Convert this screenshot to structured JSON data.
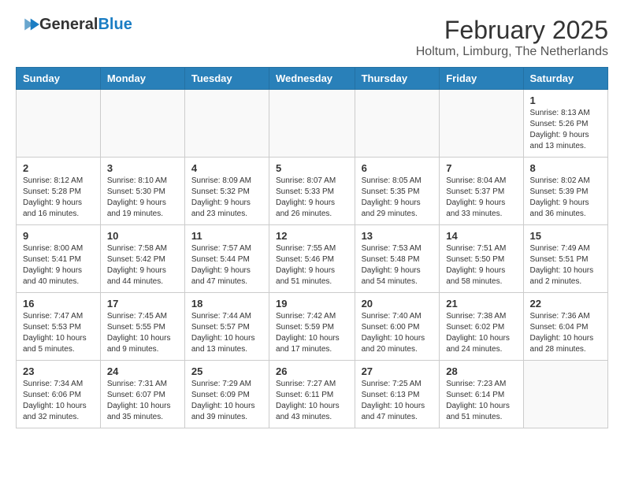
{
  "logo": {
    "general": "General",
    "blue": "Blue"
  },
  "header": {
    "month_year": "February 2025",
    "subtitle": "Holtum, Limburg, The Netherlands"
  },
  "days_of_week": [
    "Sunday",
    "Monday",
    "Tuesday",
    "Wednesday",
    "Thursday",
    "Friday",
    "Saturday"
  ],
  "weeks": [
    [
      {
        "day": "",
        "info": ""
      },
      {
        "day": "",
        "info": ""
      },
      {
        "day": "",
        "info": ""
      },
      {
        "day": "",
        "info": ""
      },
      {
        "day": "",
        "info": ""
      },
      {
        "day": "",
        "info": ""
      },
      {
        "day": "1",
        "info": "Sunrise: 8:13 AM\nSunset: 5:26 PM\nDaylight: 9 hours and 13 minutes."
      }
    ],
    [
      {
        "day": "2",
        "info": "Sunrise: 8:12 AM\nSunset: 5:28 PM\nDaylight: 9 hours and 16 minutes."
      },
      {
        "day": "3",
        "info": "Sunrise: 8:10 AM\nSunset: 5:30 PM\nDaylight: 9 hours and 19 minutes."
      },
      {
        "day": "4",
        "info": "Sunrise: 8:09 AM\nSunset: 5:32 PM\nDaylight: 9 hours and 23 minutes."
      },
      {
        "day": "5",
        "info": "Sunrise: 8:07 AM\nSunset: 5:33 PM\nDaylight: 9 hours and 26 minutes."
      },
      {
        "day": "6",
        "info": "Sunrise: 8:05 AM\nSunset: 5:35 PM\nDaylight: 9 hours and 29 minutes."
      },
      {
        "day": "7",
        "info": "Sunrise: 8:04 AM\nSunset: 5:37 PM\nDaylight: 9 hours and 33 minutes."
      },
      {
        "day": "8",
        "info": "Sunrise: 8:02 AM\nSunset: 5:39 PM\nDaylight: 9 hours and 36 minutes."
      }
    ],
    [
      {
        "day": "9",
        "info": "Sunrise: 8:00 AM\nSunset: 5:41 PM\nDaylight: 9 hours and 40 minutes."
      },
      {
        "day": "10",
        "info": "Sunrise: 7:58 AM\nSunset: 5:42 PM\nDaylight: 9 hours and 44 minutes."
      },
      {
        "day": "11",
        "info": "Sunrise: 7:57 AM\nSunset: 5:44 PM\nDaylight: 9 hours and 47 minutes."
      },
      {
        "day": "12",
        "info": "Sunrise: 7:55 AM\nSunset: 5:46 PM\nDaylight: 9 hours and 51 minutes."
      },
      {
        "day": "13",
        "info": "Sunrise: 7:53 AM\nSunset: 5:48 PM\nDaylight: 9 hours and 54 minutes."
      },
      {
        "day": "14",
        "info": "Sunrise: 7:51 AM\nSunset: 5:50 PM\nDaylight: 9 hours and 58 minutes."
      },
      {
        "day": "15",
        "info": "Sunrise: 7:49 AM\nSunset: 5:51 PM\nDaylight: 10 hours and 2 minutes."
      }
    ],
    [
      {
        "day": "16",
        "info": "Sunrise: 7:47 AM\nSunset: 5:53 PM\nDaylight: 10 hours and 5 minutes."
      },
      {
        "day": "17",
        "info": "Sunrise: 7:45 AM\nSunset: 5:55 PM\nDaylight: 10 hours and 9 minutes."
      },
      {
        "day": "18",
        "info": "Sunrise: 7:44 AM\nSunset: 5:57 PM\nDaylight: 10 hours and 13 minutes."
      },
      {
        "day": "19",
        "info": "Sunrise: 7:42 AM\nSunset: 5:59 PM\nDaylight: 10 hours and 17 minutes."
      },
      {
        "day": "20",
        "info": "Sunrise: 7:40 AM\nSunset: 6:00 PM\nDaylight: 10 hours and 20 minutes."
      },
      {
        "day": "21",
        "info": "Sunrise: 7:38 AM\nSunset: 6:02 PM\nDaylight: 10 hours and 24 minutes."
      },
      {
        "day": "22",
        "info": "Sunrise: 7:36 AM\nSunset: 6:04 PM\nDaylight: 10 hours and 28 minutes."
      }
    ],
    [
      {
        "day": "23",
        "info": "Sunrise: 7:34 AM\nSunset: 6:06 PM\nDaylight: 10 hours and 32 minutes."
      },
      {
        "day": "24",
        "info": "Sunrise: 7:31 AM\nSunset: 6:07 PM\nDaylight: 10 hours and 35 minutes."
      },
      {
        "day": "25",
        "info": "Sunrise: 7:29 AM\nSunset: 6:09 PM\nDaylight: 10 hours and 39 minutes."
      },
      {
        "day": "26",
        "info": "Sunrise: 7:27 AM\nSunset: 6:11 PM\nDaylight: 10 hours and 43 minutes."
      },
      {
        "day": "27",
        "info": "Sunrise: 7:25 AM\nSunset: 6:13 PM\nDaylight: 10 hours and 47 minutes."
      },
      {
        "day": "28",
        "info": "Sunrise: 7:23 AM\nSunset: 6:14 PM\nDaylight: 10 hours and 51 minutes."
      },
      {
        "day": "",
        "info": ""
      }
    ]
  ]
}
